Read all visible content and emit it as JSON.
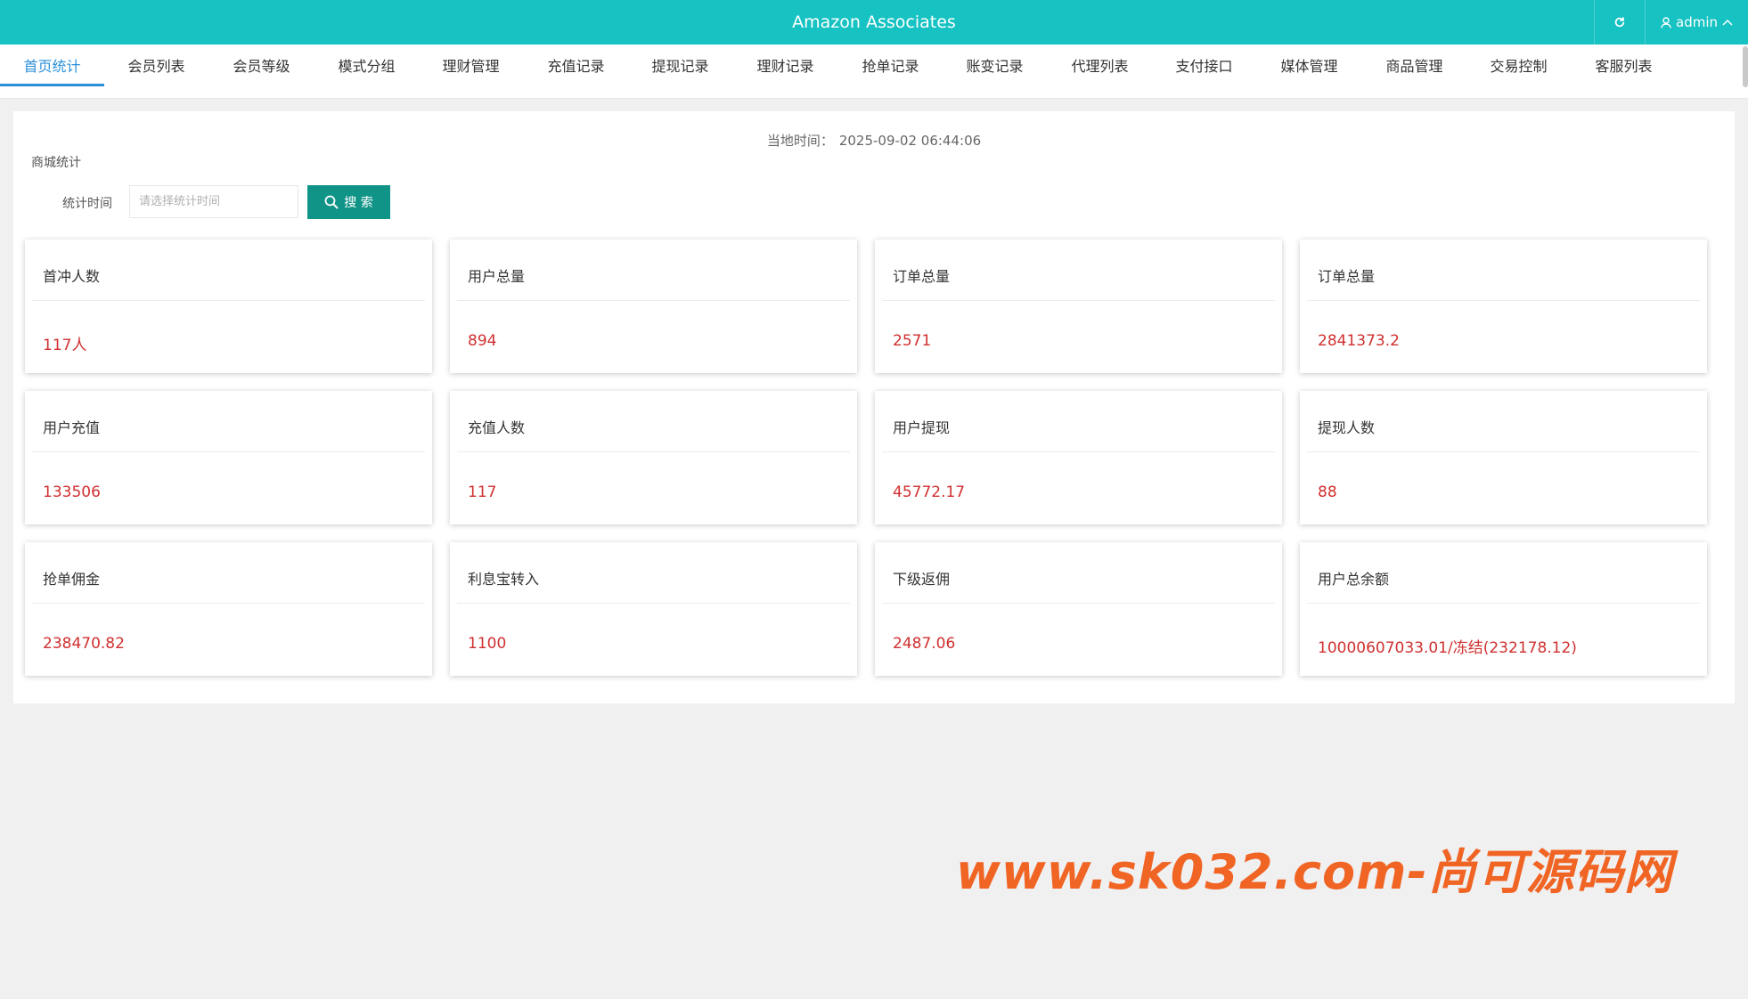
{
  "header": {
    "title": "Amazon Associates",
    "user": "admin"
  },
  "nav": {
    "tabs": [
      {
        "label": "首页统计",
        "active": true
      },
      {
        "label": "会员列表"
      },
      {
        "label": "会员等级"
      },
      {
        "label": "模式分组"
      },
      {
        "label": "理财管理"
      },
      {
        "label": "充值记录"
      },
      {
        "label": "提现记录"
      },
      {
        "label": "理财记录"
      },
      {
        "label": "抢单记录"
      },
      {
        "label": "账变记录"
      },
      {
        "label": "代理列表"
      },
      {
        "label": "支付接口"
      },
      {
        "label": "媒体管理"
      },
      {
        "label": "商品管理"
      },
      {
        "label": "交易控制"
      },
      {
        "label": "客服列表"
      }
    ]
  },
  "main": {
    "local_time_label": "当地时间：",
    "local_time_value": "2025-09-02 06:44:06",
    "section_title": "商城统计",
    "filter": {
      "label": "统计时间",
      "placeholder": "请选择统计时间",
      "search_label": "搜 索"
    },
    "cards": [
      {
        "title": "首冲人数",
        "value": "117人"
      },
      {
        "title": "用户总量",
        "value": "894"
      },
      {
        "title": "订单总量",
        "value": "2571"
      },
      {
        "title": "订单总量",
        "value": "2841373.2"
      },
      {
        "title": "用户充值",
        "value": "133506"
      },
      {
        "title": "充值人数",
        "value": "117"
      },
      {
        "title": "用户提现",
        "value": "45772.17"
      },
      {
        "title": "提现人数",
        "value": "88"
      },
      {
        "title": "抢单佣金",
        "value": "238470.82"
      },
      {
        "title": "利息宝转入",
        "value": "1100"
      },
      {
        "title": "下级返佣",
        "value": "2487.06"
      },
      {
        "title": "用户总余额",
        "value": "10000607033.01/冻结(232178.12)"
      }
    ]
  },
  "watermark": "www.sk032.com-尚可源码网",
  "colors": {
    "header_bg": "#16c2c2",
    "active_tab": "#2b90d9",
    "search_button": "#119488",
    "value_text": "#d03030",
    "watermark": "#f06424"
  }
}
